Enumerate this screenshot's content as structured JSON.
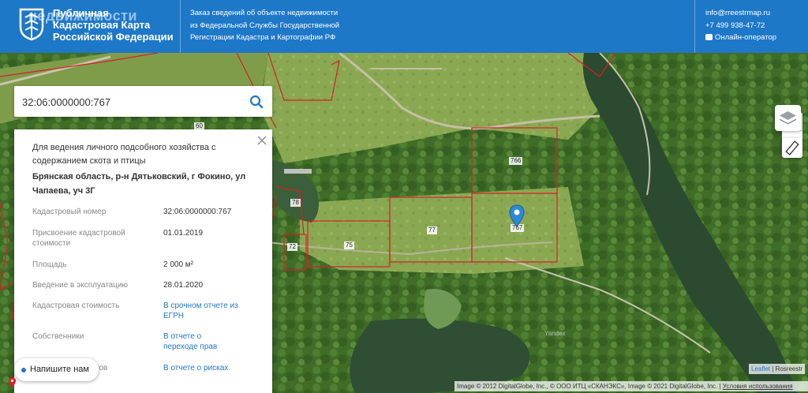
{
  "header": {
    "brand_line1": "Публичная",
    "brand_line2": "Кадастровая Карта",
    "brand_line3": "Российской Федерации",
    "watermark": "недвижимости",
    "order_line1": "Заказ сведений об объекте недвижимости",
    "order_line2": "из Федеральной Службы Государственной",
    "order_line3": "Регистрации Кадастра и Картографии РФ",
    "email": "info@rreestrmap.ru",
    "phone": "+7 499 938-47-72",
    "online_operator": "Онлайн-оператор"
  },
  "search": {
    "value": "32:06:0000000:767",
    "icon": "search-icon"
  },
  "panel": {
    "purpose": "Для ведения личного подсобного хозяйства с содержанием скота и птицы",
    "address": "Брянская область, р-н Дятьковский, г Фокино, ул Чапаева, уч 3Г",
    "rows": [
      {
        "label": "Кадастровый номер",
        "value": "32:06:0000000:767",
        "link": false
      },
      {
        "label": "Присвоение кадастровой стоимости",
        "value": "01.01.2019",
        "link": false
      },
      {
        "label": "Площадь",
        "value": "2 000 м²",
        "link": false
      },
      {
        "label": "Введение в эксплуатацию",
        "value": "28.01.2020",
        "link": false
      },
      {
        "label": "Кадастровая стоимость",
        "value": "В срочном отчете из ЕГРН",
        "link": true
      },
      {
        "label": "Собственники",
        "value": "В отчете о переходе прав",
        "link": true
      },
      {
        "label": "ков",
        "value": "В отчете о рисках",
        "link": true
      }
    ]
  },
  "chat": {
    "label": "Напишите нам"
  },
  "map": {
    "plot_labels": [
      "766",
      "77",
      "75",
      "72",
      "78",
      "60",
      "767"
    ],
    "yandex": "Yandex",
    "attribution_links": "Leaflet",
    "attribution_source": "Rosreestr",
    "copyright": "Image © 2012 DigitalGlobe, Inc., © ООО ИТЦ «СКАНЭКС», Image © 2021 DigitalGlobe, Inc.",
    "terms": "Условия использования"
  },
  "controls": {
    "zoom_in": "+",
    "zoom_out": "−"
  },
  "colors": {
    "header": "#1e78c8",
    "plot_border": "#d6202a",
    "link": "#1e78c8"
  }
}
